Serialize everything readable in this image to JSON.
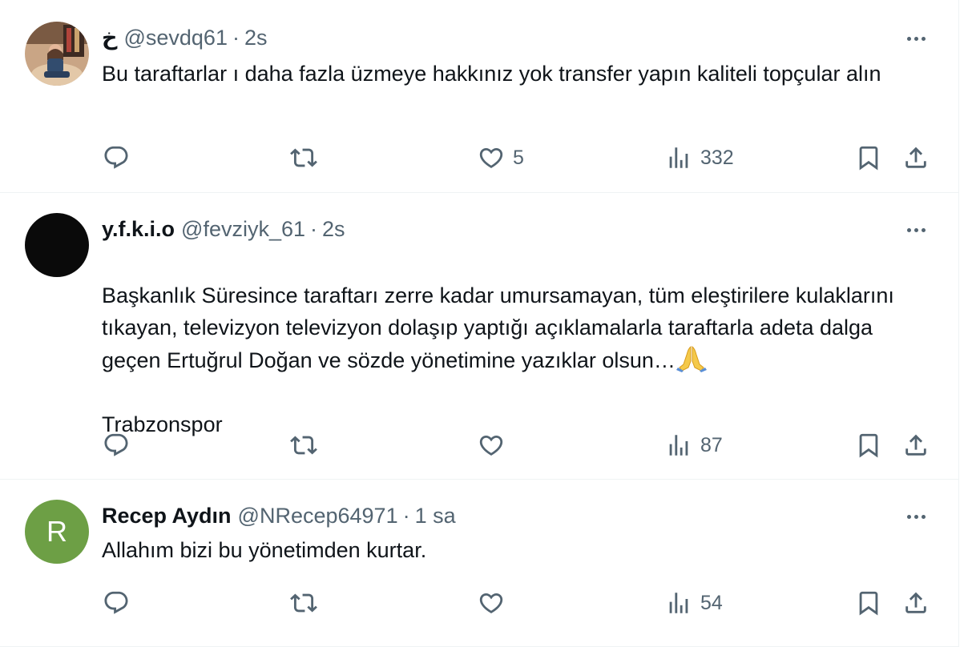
{
  "tweets": [
    {
      "name": "خ",
      "handle": "@sevdq61",
      "dot": "·",
      "time": "2s",
      "text": "Bu taraftarlar ı daha fazla üzmeye hakkınız yok transfer yapın kaliteli topçular alın",
      "avatar": "photo",
      "actions": {
        "reply": "",
        "retweet": "",
        "like": "5",
        "views": "332"
      }
    },
    {
      "name": "y.f.k.i.o",
      "handle": "@fevziyk_61",
      "dot": "·",
      "time": "2s",
      "text_main": "Başkanlık Süresince taraftarı zerre kadar umursamayan, tüm eleştirilere kulaklarını tıkayan, televizyon televizyon dolaşıp yaptığı açıklamalarla taraftarla adeta dalga geçen Ertuğrul Doğan ve sözde yönetimine yazıklar olsun…",
      "text_tail": "Trabzonspor",
      "emoji": "folded-hands-icon",
      "avatar": "black",
      "actions": {
        "reply": "",
        "retweet": "",
        "like": "",
        "views": "87"
      }
    },
    {
      "name": "Recep Aydın",
      "handle": "@NRecep64971",
      "dot": "·",
      "time": "1 sa",
      "text": "Allahım bizi bu yönetimden kurtar.",
      "avatar_letter": "R",
      "avatar_color": "#6d9f45",
      "actions": {
        "reply": "",
        "retweet": "",
        "like": "",
        "views": "54"
      }
    }
  ],
  "colors": {
    "muted": "#536471",
    "text": "#0f1419",
    "divider": "#eff3f4"
  }
}
